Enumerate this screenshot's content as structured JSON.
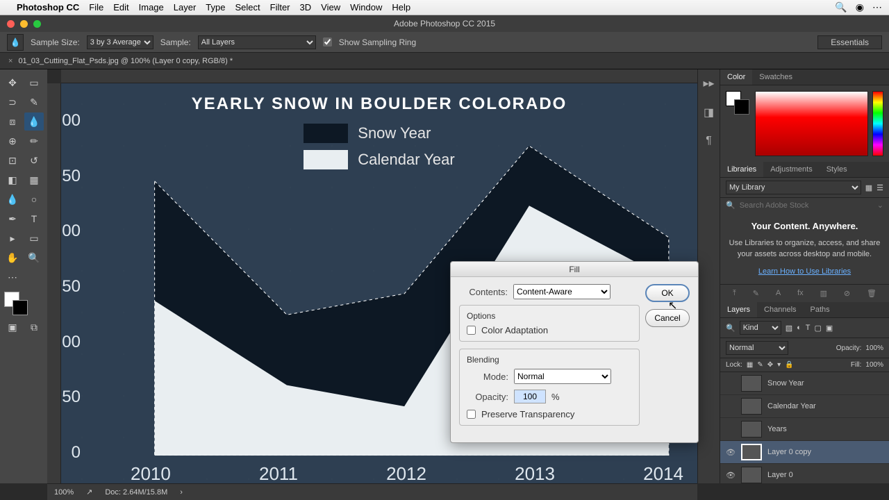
{
  "menubar": {
    "app": "Photoshop CC",
    "items": [
      "File",
      "Edit",
      "Image",
      "Layer",
      "Type",
      "Select",
      "Filter",
      "3D",
      "View",
      "Window",
      "Help"
    ]
  },
  "window_title": "Adobe Photoshop CC 2015",
  "options_bar": {
    "sample_size_label": "Sample Size:",
    "sample_size": "3 by 3 Average",
    "sample_label": "Sample:",
    "sample": "All Layers",
    "show_sampling": "Show Sampling Ring",
    "essentials": "Essentials"
  },
  "doc_tab": "01_03_Cutting_Flat_Psds.jpg @ 100% (Layer 0 copy, RGB/8) *",
  "chart_data": {
    "type": "area",
    "title": "YEARLY SNOW IN BOULDER COLORADO",
    "categories": [
      "2010",
      "2011",
      "2012",
      "2013",
      "2014"
    ],
    "series": [
      {
        "name": "Snow Year",
        "values": [
          55,
          30,
          33,
          60,
          45
        ]
      },
      {
        "name": "Calendar Year",
        "values": [
          32,
          15,
          10,
          48,
          35
        ]
      }
    ],
    "ylabel": "",
    "xlabel": "",
    "ylim": [
      0,
      60
    ],
    "y_ticks_visible": [
      "00",
      "50",
      "00",
      "50",
      "00",
      "50",
      "0"
    ],
    "legend": [
      "Snow Year",
      "Calendar Year"
    ]
  },
  "dialog": {
    "title": "Fill",
    "contents_label": "Contents:",
    "contents": "Content-Aware",
    "options_label": "Options",
    "color_adapt": "Color Adaptation",
    "blending_label": "Blending",
    "mode_label": "Mode:",
    "mode": "Normal",
    "opacity_label": "Opacity:",
    "opacity": "100",
    "pct": "%",
    "preserve": "Preserve Transparency",
    "ok": "OK",
    "cancel": "Cancel"
  },
  "panels": {
    "color_tabs": [
      "Color",
      "Swatches"
    ],
    "lib_tabs": [
      "Libraries",
      "Adjustments",
      "Styles"
    ],
    "my_library": "My Library",
    "search_ph": "Search Adobe Stock",
    "content_head": "Your Content. Anywhere.",
    "content_body": "Use Libraries to organize, access, and share your assets across desktop and mobile.",
    "learn": "Learn How to Use Libraries",
    "layer_tabs": [
      "Layers",
      "Channels",
      "Paths"
    ],
    "kind": "Kind",
    "blend": "Normal",
    "opacity_l": "Opacity:",
    "opacity_v": "100%",
    "fill_l": "Fill:",
    "fill_v": "100%",
    "lock_l": "Lock:",
    "layers": [
      {
        "name": "Snow Year",
        "eye": ""
      },
      {
        "name": "Calendar Year",
        "eye": ""
      },
      {
        "name": "Years",
        "eye": ""
      },
      {
        "name": "Layer 0 copy",
        "eye": "👁",
        "sel": true
      },
      {
        "name": "Layer 0",
        "eye": "👁"
      }
    ]
  },
  "status": {
    "zoom": "100%",
    "doc": "Doc: 2.64M/15.8M"
  }
}
